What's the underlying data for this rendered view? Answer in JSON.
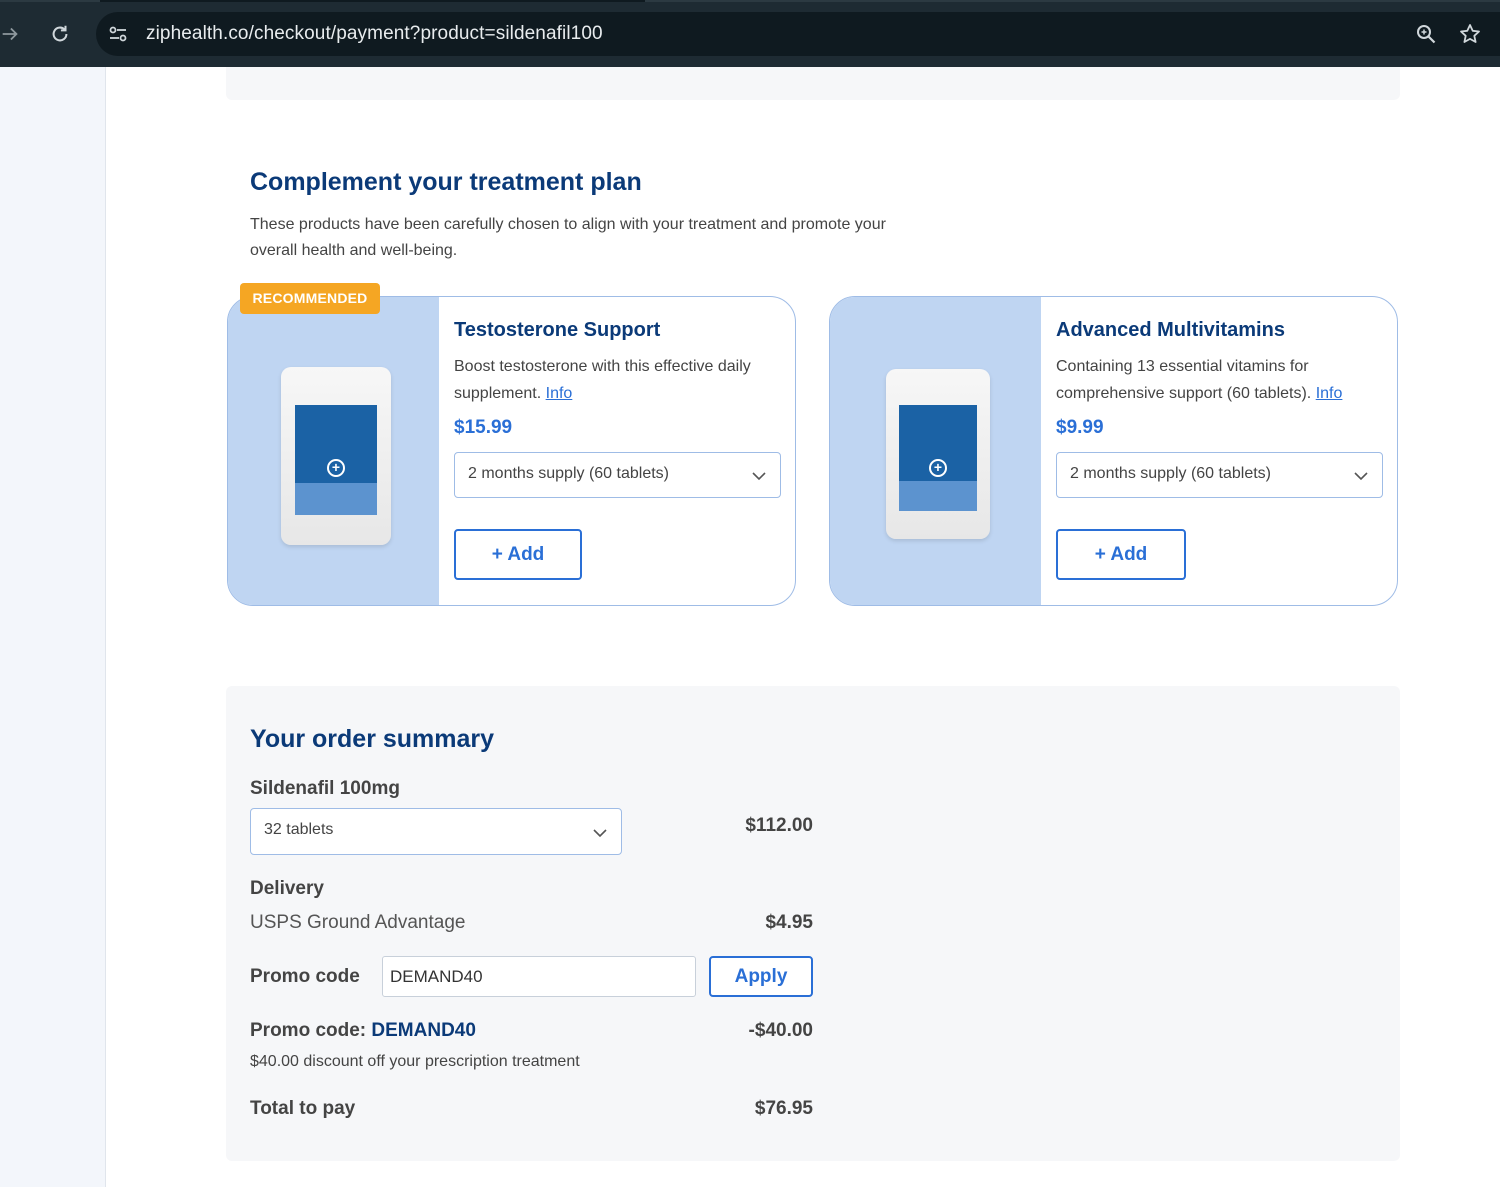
{
  "browser": {
    "url": "ziphealth.co/checkout/payment?product=sildenafil100",
    "icons": [
      "forward-icon",
      "reload-icon",
      "site-settings-icon",
      "zoom-icon",
      "bookmark-star-icon"
    ]
  },
  "complement": {
    "title": "Complement your treatment plan",
    "description": "These products have been carefully chosen to align with your treatment and promote your overall health and well-being.",
    "badge": "RECOMMENDED",
    "products": [
      {
        "name": "Testosterone Support",
        "description": "Boost testosterone with this effective daily supplement.",
        "info_link": "Info",
        "price": "$15.99",
        "supply": "2 months supply (60 tablets)",
        "add_label": "+ Add"
      },
      {
        "name": "Advanced Multivitamins",
        "description": "Containing 13 essential vitamins for comprehensive support (60 tablets).",
        "info_link": "Info",
        "price": "$9.99",
        "supply": "2 months supply (60 tablets)",
        "add_label": "+ Add"
      }
    ]
  },
  "summary": {
    "title": "Your order summary",
    "product_name": "Sildenafil 100mg",
    "quantity_option": "32 tablets",
    "product_price": "$112.00",
    "delivery_label": "Delivery",
    "delivery_method": "USPS Ground Advantage",
    "delivery_price": "$4.95",
    "promo_label": "Promo code",
    "promo_value": "DEMAND40",
    "apply_label": "Apply",
    "applied_promo_prefix": "Promo code: ",
    "applied_promo_code": "DEMAND40",
    "discount_amount": "-$40.00",
    "discount_note": "$40.00 discount off your prescription treatment",
    "total_label": "Total to pay",
    "total_value": "$76.95"
  },
  "colors": {
    "brand_navy": "#0b3a78",
    "accent_blue": "#2a6fd6",
    "badge_orange": "#f5a623",
    "card_image_bg": "#bfd5f2"
  }
}
